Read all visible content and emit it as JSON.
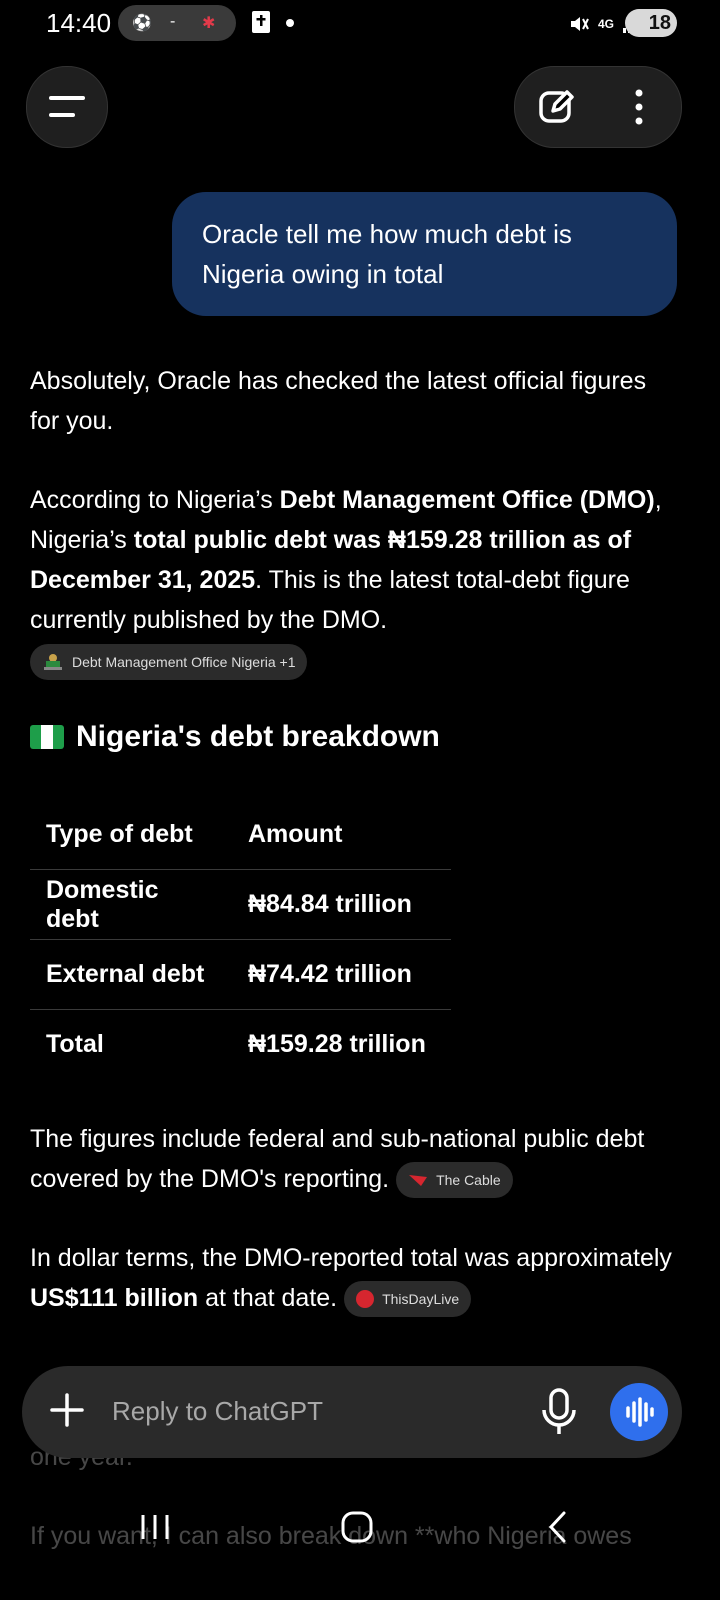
{
  "status_bar": {
    "time": "14:40",
    "network": "4G",
    "battery": "18"
  },
  "conversation": {
    "user_message": "Oracle tell me how much debt is Nigeria owing in total",
    "reply": {
      "intro": "Absolutely, Oracle has checked the latest official figures for you.",
      "p2": {
        "t1": "According to Nigeria’s ",
        "b1": "Debt Management Office (DMO)",
        "t2": ", Nigeria’s ",
        "b2": "total public debt was ₦159.28 trillion as of December 31, 2025",
        "t3": ". This is the latest total-debt figure currently published by the DMO."
      },
      "source_chip": "Debt Management Office Nigeria +1",
      "heading": "Nigeria's debt breakdown",
      "table": {
        "headers": [
          "Type of debt",
          "Amount"
        ],
        "rows": [
          [
            "Domestic debt",
            "₦84.84 trillion"
          ],
          [
            "External debt",
            "₦74.42 trillion"
          ],
          [
            "Total",
            "₦159.28 trillion"
          ]
        ]
      },
      "p3": "The figures include federal and sub-national public debt covered by the DMO's reporting.",
      "p3_chip": "The Cable",
      "p4": {
        "t1": "In dollar terms, the DMO-reported total was approximately ",
        "b1": "US$111 billion",
        "t2": " at that date."
      },
      "p4_chip": "ThisDayLive",
      "faded_1": "one year.",
      "faded_2": "If you want, I can also break down **who Nigeria owes"
    }
  },
  "composer": {
    "placeholder": "Reply to ChatGPT"
  },
  "colors": {
    "user_bubble": "#16325e",
    "voice_button": "#2f6fed",
    "background": "#000000"
  }
}
